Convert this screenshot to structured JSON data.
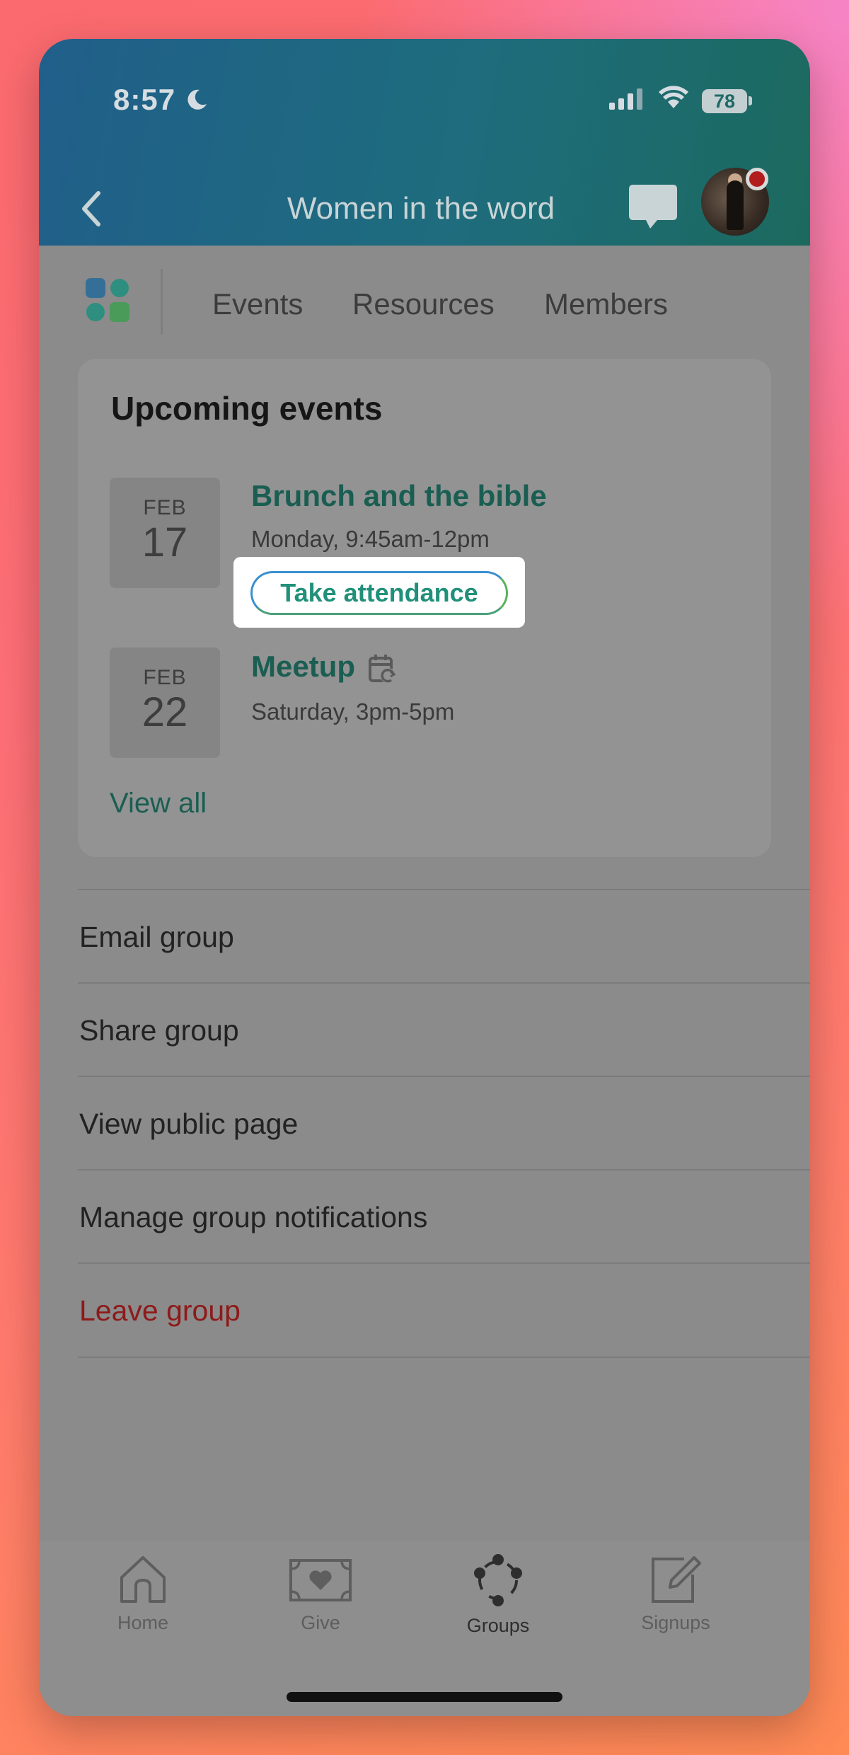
{
  "status_bar": {
    "time": "8:57",
    "battery": "78"
  },
  "header": {
    "title": "Women in the word"
  },
  "tabs": [
    {
      "label": "Events"
    },
    {
      "label": "Resources"
    },
    {
      "label": "Members"
    }
  ],
  "upcoming": {
    "title": "Upcoming events",
    "events": [
      {
        "month": "FEB",
        "day": "17",
        "name": "Brunch and the bible",
        "time": "Monday, 9:45am-12pm",
        "action": "Take attendance"
      },
      {
        "month": "FEB",
        "day": "22",
        "name": "Meetup",
        "time": "Saturday, 3pm-5pm",
        "icon": "recurring-calendar-icon"
      }
    ],
    "view_all": "View all"
  },
  "actions": [
    {
      "label": "Email group"
    },
    {
      "label": "Share group"
    },
    {
      "label": "View public page"
    },
    {
      "label": "Manage group notifications"
    },
    {
      "label": "Leave group"
    }
  ],
  "bottom_nav": [
    {
      "label": "Home",
      "icon": "home-icon"
    },
    {
      "label": "Give",
      "icon": "give-icon"
    },
    {
      "label": "Groups",
      "icon": "groups-icon",
      "active": true
    },
    {
      "label": "Signups",
      "icon": "signups-icon"
    }
  ],
  "colors": {
    "accent": "#21907a",
    "danger": "#8e1a1a",
    "header_start": "#205f8a",
    "header_end": "#1c6a5e"
  }
}
